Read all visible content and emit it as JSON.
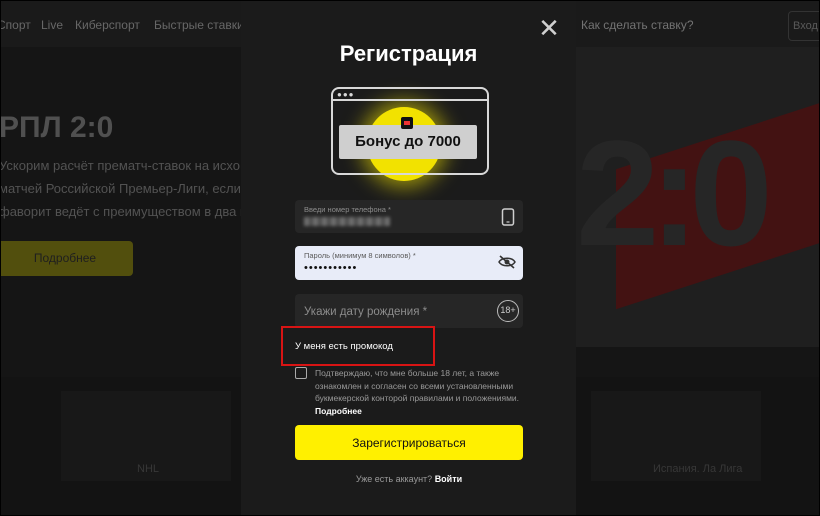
{
  "background": {
    "nav": [
      "Спорт",
      "Live",
      "Киберспорт",
      "Быстрые ставки",
      "Как сделать ставку?",
      "Вход"
    ],
    "hero_title": "РПЛ 2:0",
    "hero_lines": [
      "Ускорим расчёт прематч-ставок на исхо...",
      "матчей Российской Премьер-Лиги, если",
      "фаворит ведёт с преимуществом в два г..."
    ],
    "hero_button": "Подробнее",
    "cards": [
      "NHL",
      "Испания. Ла Лига"
    ]
  },
  "modal": {
    "title": "Регистрация",
    "promo_label": "Бонус до 7000",
    "phone_label": "Введи номер телефона *",
    "phone_value": "+7 ••••••••••",
    "password_label": "Пароль (минимум 8 символов) *",
    "password_value": "•••••••••••",
    "birthdate_placeholder": "Укажи дату рождения *",
    "age_badge": "18+",
    "promo_link": "У меня есть промокод",
    "terms_text": "Подтверждаю, что мне больше 18 лет, а также ознакомлен и согласен со всеми установленными букмекерской конторой правилами и положениями.",
    "terms_more": "Подробнее",
    "submit_label": "Зарегистрироваться",
    "login_prompt": "Уже есть аккаунт?",
    "login_link": "Войти",
    "close": "✕"
  },
  "colors": {
    "accent": "#fff000",
    "highlight_box": "#d81414",
    "modal_bg": "#1b1b1b"
  }
}
